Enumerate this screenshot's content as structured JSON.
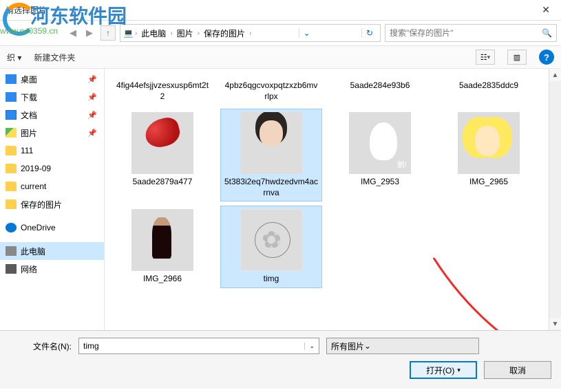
{
  "title": "请选择图片",
  "watermark": {
    "text": "河东软件园",
    "url": "www.pc0359.cn"
  },
  "breadcrumb": {
    "pc": "此电脑",
    "pictures": "图片",
    "saved": "保存的图片"
  },
  "search": {
    "placeholder": "搜索\"保存的图片\""
  },
  "toolbar": {
    "organize": "织 ▾",
    "newfolder": "新建文件夹"
  },
  "sidebar": {
    "items": [
      {
        "label": "桌面",
        "icon": "ic-desktop",
        "pinned": true
      },
      {
        "label": "下载",
        "icon": "ic-download",
        "pinned": true
      },
      {
        "label": "文档",
        "icon": "ic-doc",
        "pinned": true
      },
      {
        "label": "图片",
        "icon": "ic-pic",
        "pinned": true
      },
      {
        "label": "111",
        "icon": "ic-folder"
      },
      {
        "label": "2019-09",
        "icon": "ic-folder"
      },
      {
        "label": "current",
        "icon": "ic-folder"
      },
      {
        "label": "保存的图片",
        "icon": "ic-folder"
      },
      {
        "label": "OneDrive",
        "icon": "ic-cloud"
      },
      {
        "label": "此电脑",
        "icon": "ic-pc",
        "active": true
      },
      {
        "label": "网络",
        "icon": "ic-net"
      }
    ]
  },
  "files": {
    "row1": [
      {
        "name": "4fig44efsjjvzesxusp6mt2t2"
      },
      {
        "name": "4pbz6qgcvoxpqtzxzb6mvrlpx"
      },
      {
        "name": "5aade284e93b6"
      },
      {
        "name": "5aade2835ddc9"
      }
    ],
    "row2": [
      {
        "name": "5aade2879a477",
        "thumb": "thumb-red"
      },
      {
        "name": "5t383i2eq7hwdzedvm4acrnva",
        "thumb": "thumb-child",
        "selected": true
      },
      {
        "name": "IMG_2953",
        "thumb": "thumb-goose"
      },
      {
        "name": "IMG_2965",
        "thumb": "thumb-alice"
      }
    ],
    "row3": [
      {
        "name": "IMG_2966",
        "thumb": "thumb-dark"
      },
      {
        "name": "timg",
        "thumb": "thumb-flower",
        "selected": true
      }
    ]
  },
  "footer": {
    "filename_label": "文件名(N):",
    "filename_value": "timg",
    "filter": "所有图片",
    "open": "打开(O)",
    "cancel": "取消"
  }
}
